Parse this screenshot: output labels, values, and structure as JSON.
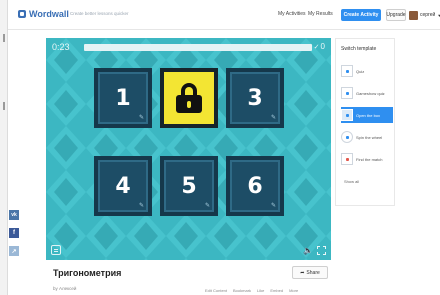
{
  "header": {
    "brand": "Wordwall",
    "tagline": "Create better lessons quicker",
    "nav": [
      "My Activities",
      "My Results"
    ],
    "create_label": "Create Activity",
    "upgrade_label": "Upgrade",
    "user_name": "сергей"
  },
  "game": {
    "timer": "0:23",
    "score": "0",
    "tiles": [
      {
        "label": "1",
        "locked": false
      },
      {
        "label": "",
        "locked": true
      },
      {
        "label": "3",
        "locked": false
      },
      {
        "label": "4",
        "locked": false
      },
      {
        "label": "5",
        "locked": false
      },
      {
        "label": "6",
        "locked": false
      }
    ]
  },
  "activity": {
    "title": "Тригонометрия",
    "author": "by Алексей",
    "share_label": "Share",
    "actions": [
      "Edit Content",
      "Bookmark",
      "Like",
      "Embed",
      "More"
    ]
  },
  "templates": {
    "title": "Switch template",
    "items": [
      {
        "label": "Quiz",
        "active": false
      },
      {
        "label": "Gameshow quiz",
        "active": false
      },
      {
        "label": "Open the box",
        "active": true
      },
      {
        "label": "Spin the wheel",
        "active": false
      },
      {
        "label": "Find the match",
        "active": false
      }
    ],
    "show_all": "Show all"
  },
  "social": {
    "vk": "vk",
    "facebook": "f",
    "other": "↗"
  },
  "colors": {
    "accent": "#2f8ff0",
    "game_bg": "#3cb7c2",
    "tile": "#1d4d66",
    "locked_tile": "#f3e533"
  }
}
